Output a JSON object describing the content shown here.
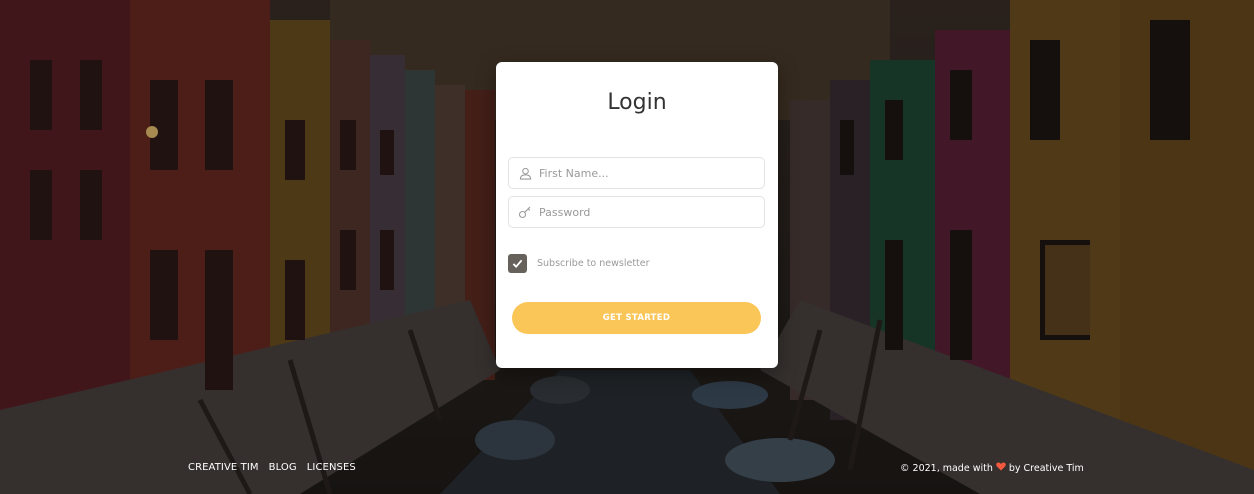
{
  "login": {
    "title": "Login",
    "first_name_placeholder": "First Name...",
    "password_placeholder": "Password",
    "subscribe_label": "Subscribe to newsletter",
    "subscribe_checked": true,
    "submit_label": "GET STARTED"
  },
  "footer": {
    "links": [
      "CREATIVE TIM",
      "BLOG",
      "LICENSES"
    ],
    "credits_prefix": "© 2021, made with",
    "credits_suffix": "by Creative Tim"
  },
  "colors": {
    "accent": "#fbc658",
    "checkbox": "#66615b",
    "heart": "#f5593d"
  },
  "icons": {
    "first_name": "user-icon",
    "password": "key-icon",
    "checkbox": "checkmark-icon",
    "credits": "heart-icon"
  }
}
